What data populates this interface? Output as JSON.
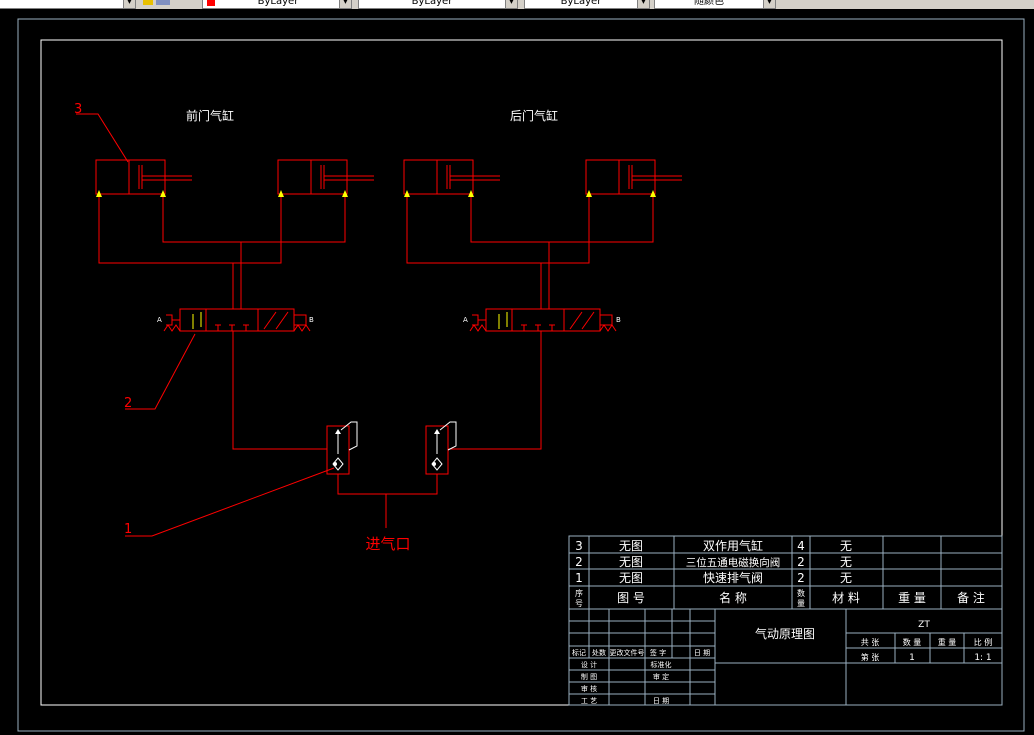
{
  "toolbar": {
    "layer_icons_label": "",
    "color_combo": "ByLayer",
    "linetype_combo": "ByLayer",
    "lineweight_combo": "ByLayer",
    "plotstyle_combo": "随颜色"
  },
  "drawing": {
    "label_front_cylinder": "前门气缸",
    "label_rear_cylinder": "后门气缸",
    "label_inlet": "进气口",
    "callouts": [
      "3",
      "2",
      "1"
    ],
    "valve_port_a": "A",
    "valve_port_b": "B"
  },
  "title_block": {
    "parts": [
      {
        "no": "3",
        "drawing_no": "无图",
        "name": "双作用气缸",
        "qty": "4",
        "material": "无"
      },
      {
        "no": "2",
        "drawing_no": "无图",
        "name": "三位五通电磁换向阀",
        "qty": "2",
        "material": "无"
      },
      {
        "no": "1",
        "drawing_no": "无图",
        "name": "快速排气阀",
        "qty": "2",
        "material": "无"
      }
    ],
    "headers": {
      "no_top": "序",
      "no_bottom": "号",
      "drawing_no": "图  号",
      "name": "名  称",
      "qty_top": "数",
      "qty_bottom": "量",
      "material": "材  料",
      "weight": "重  量",
      "remark": "备 注"
    },
    "drawing_title": "气动原理图",
    "company": "ZT",
    "rev_headers": [
      "标记",
      "处数",
      "更改文件号",
      "签 字",
      "日 期"
    ],
    "sign_rows": [
      {
        "left": "设  计",
        "right": "标准化"
      },
      {
        "left": "制  图",
        "right": "审  定"
      },
      {
        "left": "审  核",
        "right": ""
      },
      {
        "left": "工  艺",
        "right": "日  期"
      }
    ],
    "info_headers": [
      "共  张",
      "数  量",
      "重  量",
      "比  例"
    ],
    "info_values": [
      "第  张",
      "1",
      "",
      "1: 1"
    ]
  }
}
